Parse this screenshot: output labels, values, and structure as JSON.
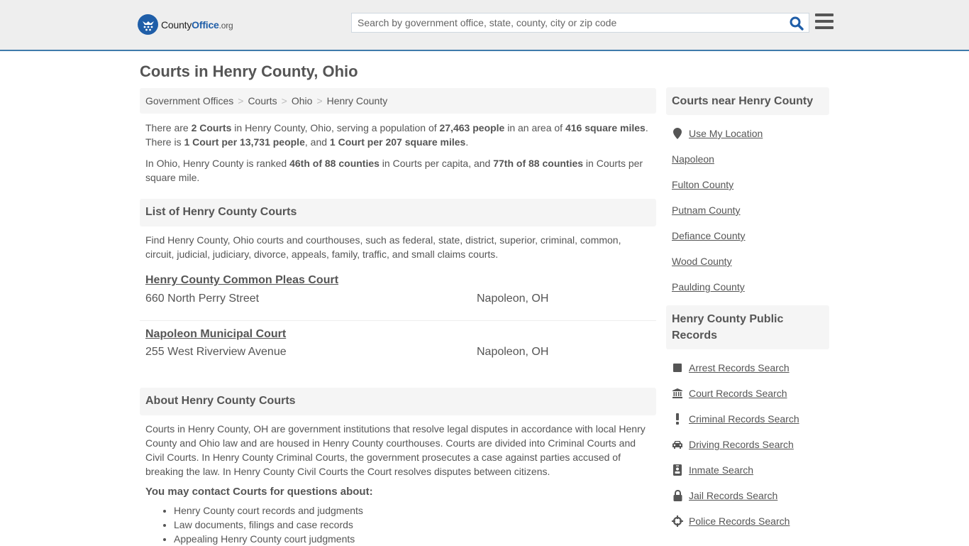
{
  "header": {
    "logo": {
      "name": "County",
      "name_accent": "Office",
      "tld": ".org"
    },
    "search": {
      "placeholder": "Search by government office, state, county, city or zip code",
      "value": ""
    },
    "icons": {
      "search": "search-icon",
      "menu": "hamburger-menu-icon"
    }
  },
  "page": {
    "title": "Courts in Henry County, Ohio"
  },
  "breadcrumb": [
    {
      "label": "Government Offices"
    },
    {
      "label": "Courts"
    },
    {
      "label": "Ohio"
    },
    {
      "label": "Henry County"
    }
  ],
  "breadcrumb_separator": ">",
  "intro": {
    "p1": {
      "t1": "There are ",
      "b1": "2 Courts",
      "t2": " in Henry County, Ohio, serving a population of ",
      "b2": "27,463 people",
      "t3": " in an area of ",
      "b3": "416 square miles",
      "t4": ". There is ",
      "b4": "1 Court per 13,731 people",
      "t5": ", and ",
      "b5": "1 Court per 207 square miles",
      "t6": "."
    },
    "p2": {
      "t1": "In Ohio, Henry County is ranked ",
      "b1": "46th of 88 counties",
      "t2": " in Courts per capita, and ",
      "b2": "77th of 88 counties",
      "t3": " in Courts per square mile."
    }
  },
  "list_section": {
    "heading": "List of Henry County Courts",
    "description": "Find Henry County, Ohio courts and courthouses, such as federal, state, district, superior, criminal, common, circuit, judicial, judiciary, divorce, appeals, family, traffic, and small claims courts.",
    "courts": [
      {
        "name": "Henry County Common Pleas Court",
        "address": "660 North Perry Street",
        "city": "Napoleon, OH"
      },
      {
        "name": "Napoleon Municipal Court",
        "address": "255 West Riverview Avenue",
        "city": "Napoleon, OH"
      }
    ]
  },
  "about_section": {
    "heading": "About Henry County Courts",
    "body": "Courts in Henry County, OH are government institutions that resolve legal disputes in accordance with local Henry County and Ohio law and are housed in Henry County courthouses. Courts are divided into Criminal Courts and Civil Courts. In Henry County Criminal Courts, the government prosecutes a case against parties accused of breaking the law. In Henry County Civil Courts the Court resolves disputes between citizens.",
    "contact_heading": "You may contact Courts for questions about:",
    "contact_items": [
      "Henry County court records and judgments",
      "Law documents, filings and case records",
      "Appealing Henry County court judgments"
    ]
  },
  "sidebar": {
    "near": {
      "heading": "Courts near Henry County",
      "location_label": "Use My Location",
      "location_icon": "map-marker-icon",
      "items": [
        "Napoleon",
        "Fulton County",
        "Putnam County",
        "Defiance County",
        "Wood County",
        "Paulding County"
      ]
    },
    "records": {
      "heading": "Henry County Public Records",
      "items": [
        {
          "label": "Arrest Records Search",
          "icon": "square-icon"
        },
        {
          "label": "Court Records Search",
          "icon": "courthouse-icon"
        },
        {
          "label": "Criminal Records Search",
          "icon": "exclamation-icon"
        },
        {
          "label": "Driving Records Search",
          "icon": "car-icon"
        },
        {
          "label": "Inmate Search",
          "icon": "id-badge-icon"
        },
        {
          "label": "Jail Records Search",
          "icon": "lock-icon"
        },
        {
          "label": "Police Records Search",
          "icon": "crosshairs-icon"
        }
      ]
    }
  },
  "colors": {
    "brand_blue": "#1f5ea8",
    "header_border": "#3f7bab",
    "text": "#555555",
    "panel_bg": "#f5f5f5"
  }
}
